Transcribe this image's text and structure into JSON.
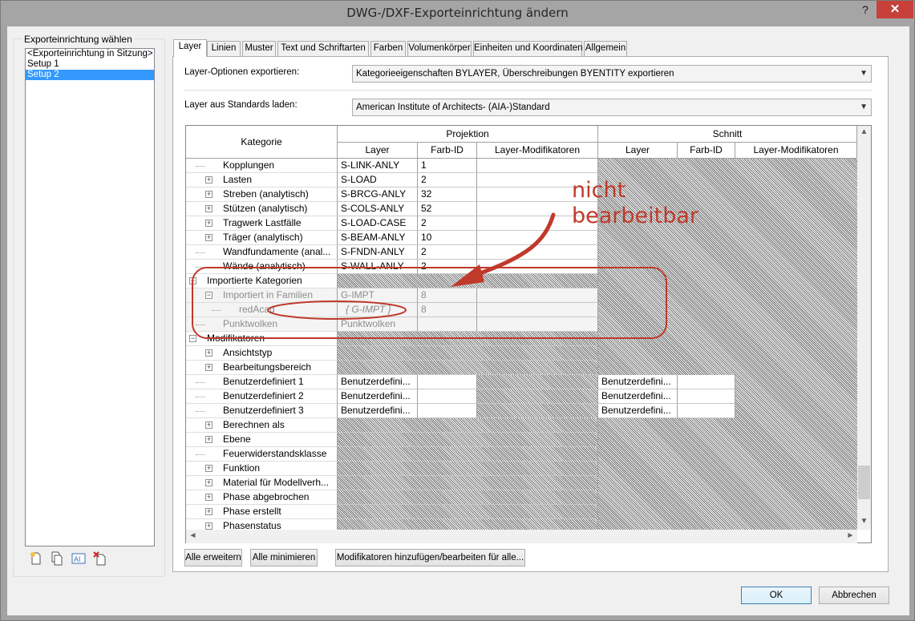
{
  "window": {
    "title": "DWG-/DXF-Exporteinrichtung ändern",
    "help": "?",
    "close": "✕"
  },
  "left": {
    "group_label": "Exporteinrichtung wählen",
    "setups": [
      "<Exporteinrichtung in Sitzung>",
      "Setup 1",
      "Setup 2"
    ],
    "selected_index": 2,
    "tool_icons": [
      "new-setup-icon",
      "duplicate-setup-icon",
      "rename-setup-icon",
      "delete-setup-icon"
    ]
  },
  "tabs": [
    "Layer",
    "Linien",
    "Muster",
    "Text und Schriftarten",
    "Farben",
    "Volumenkörper",
    "Einheiten und Koordinaten",
    "Allgemein"
  ],
  "options": {
    "layer_options_label": "Layer-Optionen exportieren:",
    "layer_options_value": "Kategorieeigenschaften BYLAYER, Überschreibungen  BYENTITY exportieren",
    "standard_label": "Layer aus Standards laden:",
    "standard_value": "American Institute of Architects- (AIA-)Standard"
  },
  "grid": {
    "col_kategorie": "Kategorie",
    "group_projektion": "Projektion",
    "group_schnitt": "Schnitt",
    "col_layer": "Layer",
    "col_farb_id": "Farb-ID",
    "col_modifikatoren": "Layer-Modifikatoren",
    "rows": [
      {
        "cat": "Kopplungen",
        "expander": "",
        "layer": "S-LINK-ANLY",
        "color": "1"
      },
      {
        "cat": "Lasten",
        "expander": "+",
        "layer": "S-LOAD",
        "color": "2"
      },
      {
        "cat": "Streben (analytisch)",
        "expander": "+",
        "layer": "S-BRCG-ANLY",
        "color": "32"
      },
      {
        "cat": "Stützen (analytisch)",
        "expander": "+",
        "layer": "S-COLS-ANLY",
        "color": "52"
      },
      {
        "cat": "Tragwerk Lastfälle",
        "expander": "+",
        "layer": "S-LOAD-CASE",
        "color": "2"
      },
      {
        "cat": "Träger (analytisch)",
        "expander": "+",
        "layer": "S-BEAM-ANLY",
        "color": "10"
      },
      {
        "cat": "Wandfundamente (anal...",
        "expander": "",
        "layer": "S-FNDN-ANLY",
        "color": "2"
      },
      {
        "cat": "Wände (analytisch)",
        "expander": "",
        "layer": "S-WALL-ANLY",
        "color": "2"
      },
      {
        "cat": "Importierte Kategorien",
        "expander": "−",
        "layer": "",
        "color": ""
      },
      {
        "cat": "Importiert in Familien",
        "expander": "−",
        "layer": "G-IMPT",
        "color": "8"
      },
      {
        "cat": "redAcad",
        "expander": "",
        "layer": "{ G-IMPT }",
        "color": "8"
      },
      {
        "cat": "Punktwolken",
        "expander": "",
        "layer": "Punktwolken",
        "color": ""
      },
      {
        "cat": "Modifikatoren",
        "expander": "−",
        "layer": "",
        "color": ""
      },
      {
        "cat": "Ansichtstyp",
        "expander": "+",
        "layer": "",
        "color": ""
      },
      {
        "cat": "Bearbeitungsbereich",
        "expander": "+",
        "layer": "",
        "color": ""
      },
      {
        "cat": "Benutzerdefiniert 1",
        "expander": "",
        "layer": "Benutzerdefini...",
        "color": "",
        "cut_layer": "Benutzerdefini..."
      },
      {
        "cat": "Benutzerdefiniert 2",
        "expander": "",
        "layer": "Benutzerdefini...",
        "color": "",
        "cut_layer": "Benutzerdefini..."
      },
      {
        "cat": "Benutzerdefiniert 3",
        "expander": "",
        "layer": "Benutzerdefini...",
        "color": "",
        "cut_layer": "Benutzerdefini..."
      },
      {
        "cat": "Berechnen als",
        "expander": "+",
        "layer": "",
        "color": ""
      },
      {
        "cat": "Ebene",
        "expander": "+",
        "layer": "",
        "color": ""
      },
      {
        "cat": "Feuerwiderstandsklasse",
        "expander": "",
        "layer": "",
        "color": ""
      },
      {
        "cat": "Funktion",
        "expander": "+",
        "layer": "",
        "color": ""
      },
      {
        "cat": "Material für Modellverh...",
        "expander": "+",
        "layer": "",
        "color": ""
      },
      {
        "cat": "Phase abgebrochen",
        "expander": "+",
        "layer": "",
        "color": ""
      },
      {
        "cat": "Phase erstellt",
        "expander": "+",
        "layer": "",
        "color": ""
      },
      {
        "cat": "Phasenstatus",
        "expander": "+",
        "layer": "",
        "color": ""
      }
    ]
  },
  "buttons": {
    "expand_all": "Alle erweitern",
    "collapse_all": "Alle  minimieren",
    "modifiers": "Modifikatoren hinzufügen/bearbeiten für alle...",
    "ok": "OK",
    "cancel": "Abbrechen"
  },
  "annotation": {
    "text_line1": "nicht",
    "text_line2": "bearbeitbar",
    "color": "#c0392b"
  }
}
